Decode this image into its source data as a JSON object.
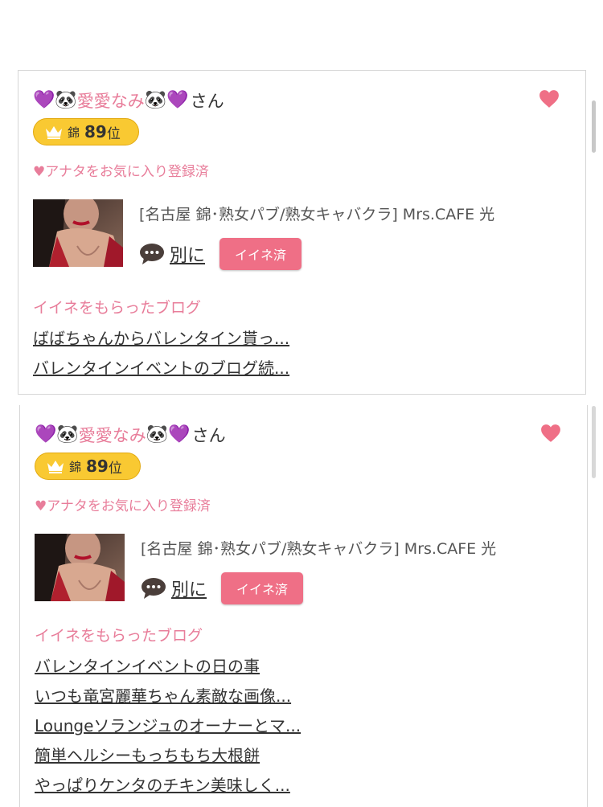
{
  "cards": [
    {
      "emoji_left": "💜🐼",
      "name": "愛愛なみ",
      "emoji_right": "🐼💜",
      "honorific": "さん",
      "rank_area": "錦",
      "rank_number": "89",
      "rank_suffix": "位",
      "favorite_status": "♥アナタをお気に入り登録済",
      "shop": "[名古屋 錦･熟女パブ/熟女キャバクラ]  Mrs.CAFE 光",
      "message_label": "別に",
      "iine_button": "イイネ済",
      "blog_heading": "イイネをもらったブログ",
      "blogs": [
        "ばばちゃんからバレンタイン貰っ...",
        "バレンタインイベントのブログ続..."
      ]
    },
    {
      "emoji_left": "💜🐼",
      "name": "愛愛なみ",
      "emoji_right": "🐼💜",
      "honorific": "さん",
      "rank_area": "錦",
      "rank_number": "89",
      "rank_suffix": "位",
      "favorite_status": "♥アナタをお気に入り登録済",
      "shop": "[名古屋 錦･熟女パブ/熟女キャバクラ]  Mrs.CAFE 光",
      "message_label": "別に",
      "iine_button": "イイネ済",
      "blog_heading": "イイネをもらったブログ",
      "blogs": [
        "バレンタインイベントの日の事",
        "いつも竜宮麗華ちゃん素敵な画像...",
        "Loungeソランジュのオーナーとマ...",
        "簡単ヘルシーもっちもち大根餅",
        "やっぱりケンタのチキン美味しく..."
      ]
    }
  ],
  "colors": {
    "accent_pink": "#e87d9a",
    "button_pink": "#ef6f86",
    "rank_gold": "#f9c932"
  },
  "icons": {
    "favorite": "heart-icon",
    "rank": "crown-icon",
    "message": "speech-bubble-icon"
  }
}
